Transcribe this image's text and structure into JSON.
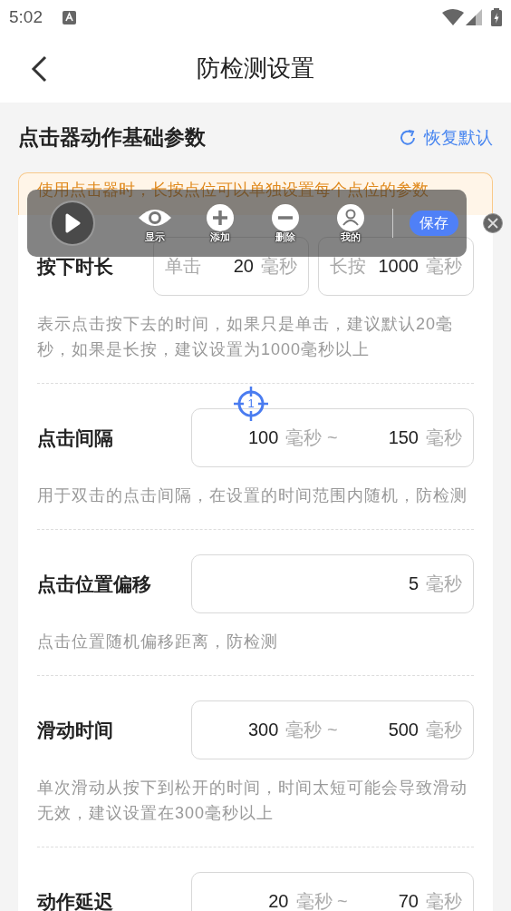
{
  "status_bar": {
    "time": "5:02"
  },
  "header": {
    "title": "防检测设置"
  },
  "section": {
    "title": "点击器动作基础参数",
    "restore_link": "恢复默认"
  },
  "notice": "使用点击器时，长按点位可以单独设置每个点位的参数",
  "settings": [
    {
      "label": "按下时长",
      "inputs": [
        [
          {
            "kind": "label",
            "text": "单击"
          },
          {
            "kind": "value",
            "text": "20"
          },
          {
            "kind": "unit",
            "text": "毫秒"
          }
        ],
        [
          {
            "kind": "label",
            "text": "长按"
          },
          {
            "kind": "value",
            "text": "1000"
          },
          {
            "kind": "unit",
            "text": "毫秒"
          }
        ]
      ],
      "description": "表示点击按下去的时间，如果只是单击，建议默认20毫秒，如果是长按，建议设置为1000毫秒以上"
    },
    {
      "label": "点击间隔",
      "inputs": [
        [
          {
            "kind": "value",
            "text": "100"
          },
          {
            "kind": "unit",
            "text": "毫秒 ~"
          },
          {
            "kind": "value",
            "text": "150"
          },
          {
            "kind": "unit",
            "text": "毫秒"
          }
        ]
      ],
      "description": "用于双击的点击间隔，在设置的时间范围内随机，防检测"
    },
    {
      "label": "点击位置偏移",
      "inputs": [
        [
          {
            "kind": "value",
            "text": "5"
          },
          {
            "kind": "unit",
            "text": "毫秒"
          }
        ]
      ],
      "description": "点击位置随机偏移距离，防检测"
    },
    {
      "label": "滑动时间",
      "inputs": [
        [
          {
            "kind": "value",
            "text": "300"
          },
          {
            "kind": "unit",
            "text": "毫秒 ~"
          },
          {
            "kind": "value",
            "text": "500"
          },
          {
            "kind": "unit",
            "text": "毫秒"
          }
        ]
      ],
      "description": "单次滑动从按下到松开的时间，时间太短可能会导致滑动无效，建议设置在300毫秒以上"
    },
    {
      "label": "动作延迟",
      "inputs": [
        [
          {
            "kind": "value",
            "text": "20"
          },
          {
            "kind": "unit",
            "text": "毫秒 ~"
          },
          {
            "kind": "value",
            "text": "70"
          },
          {
            "kind": "unit",
            "text": "毫秒"
          }
        ]
      ]
    }
  ],
  "float_toolbar": {
    "items": [
      {
        "kind": "eye",
        "label": "显示"
      },
      {
        "kind": "plus",
        "label": "添加"
      },
      {
        "kind": "minus",
        "label": "删除"
      },
      {
        "kind": "person",
        "label": "我的"
      }
    ],
    "save_button": "保存"
  },
  "tap_marker": {
    "label": "1"
  }
}
